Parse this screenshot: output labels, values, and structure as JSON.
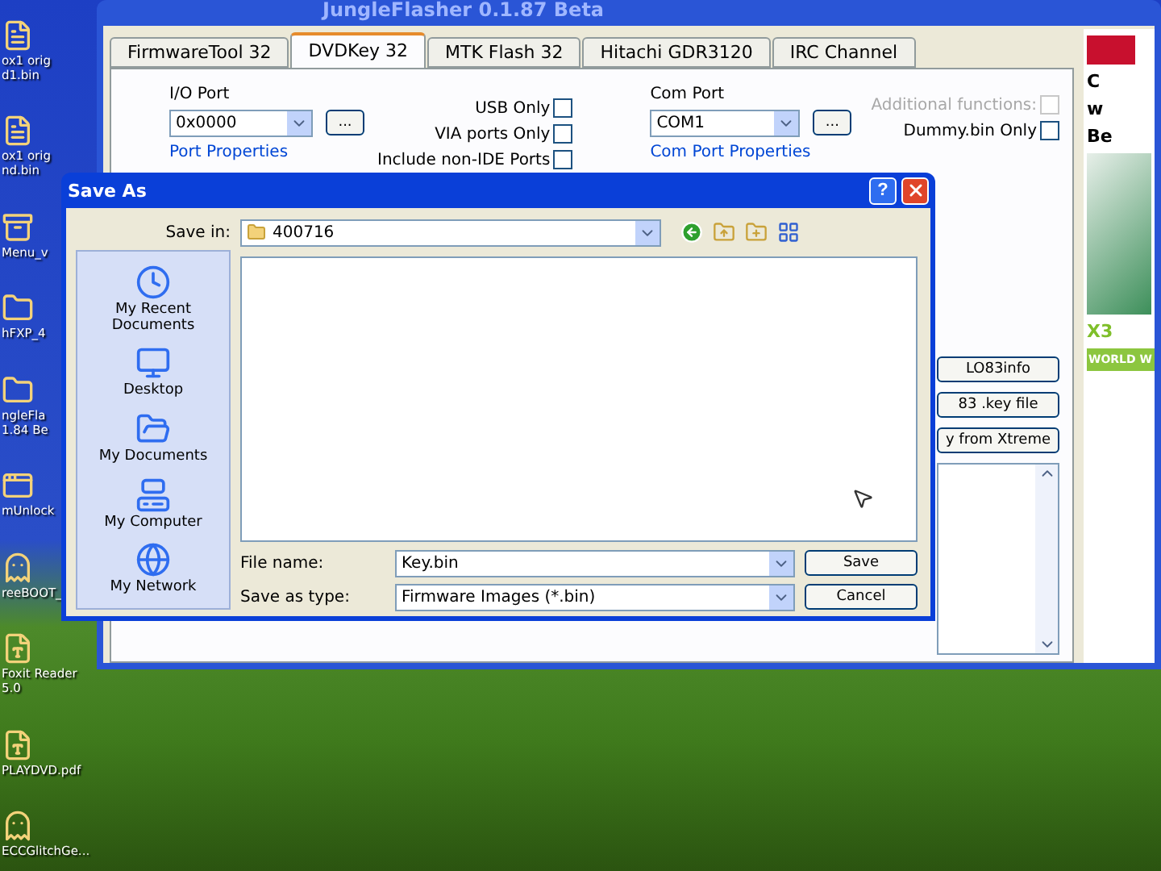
{
  "desktop": {
    "icons": [
      {
        "kind": "file",
        "lines": [
          "ox1 orig",
          "d1.bin"
        ]
      },
      {
        "kind": "file",
        "lines": [
          "ox1 orig",
          "nd.bin"
        ]
      },
      {
        "kind": "archive",
        "lines": [
          "Menu_v"
        ]
      },
      {
        "kind": "folder",
        "lines": [
          "hFXP_4"
        ]
      },
      {
        "kind": "folder",
        "lines": [
          "ngleFla",
          "1.84 Be"
        ]
      },
      {
        "kind": "window",
        "lines": [
          "mUnlock"
        ]
      },
      {
        "kind": "creature",
        "lines": [
          "reeBOOT_"
        ]
      },
      {
        "kind": "app",
        "lines": [
          "Foxit Reader",
          "5.0"
        ]
      },
      {
        "kind": "pdf",
        "lines": [
          "PLAYDVD.pdf"
        ]
      },
      {
        "kind": "creature",
        "lines": [
          "ECCGlitchGe..."
        ]
      }
    ]
  },
  "app_window": {
    "title": "JungleFlasher 0.1.87 Beta",
    "tabs": [
      {
        "label": "FirmwareTool 32",
        "selected": false
      },
      {
        "label": "DVDKey 32",
        "selected": true
      },
      {
        "label": "MTK Flash 32",
        "selected": false
      },
      {
        "label": "Hitachi GDR3120",
        "selected": false
      },
      {
        "label": "IRC Channel",
        "selected": false
      }
    ],
    "io_port": {
      "label": "I/O Port",
      "value": "0x0000",
      "browse": "...",
      "group": "Port Properties"
    },
    "port_options": [
      {
        "label": "USB Only",
        "checked": false
      },
      {
        "label": "VIA ports Only",
        "checked": false
      },
      {
        "label": "Include non-IDE Ports",
        "checked": false
      }
    ],
    "com_port": {
      "label": "Com Port",
      "value": "COM1",
      "browse": "...",
      "group": "Com Port Properties"
    },
    "extra_options": [
      {
        "label": "Additional functions:",
        "checked": false,
        "disabled": true
      },
      {
        "label": "Dummy.bin Only",
        "checked": false,
        "disabled": false
      }
    ],
    "buttons": [
      "LO83info",
      "83 .key file",
      "y from Xtreme"
    ],
    "ad": {
      "lines": [
        "C",
        "w",
        "Be"
      ],
      "brand": "X3",
      "banner": "WORLD W"
    }
  },
  "save_dialog": {
    "title": "Save As",
    "help": "?",
    "save_in": {
      "label": "Save in:",
      "value": "400716"
    },
    "places": [
      {
        "kind": "recent",
        "label": "My Recent Documents"
      },
      {
        "kind": "desktop",
        "label": "Desktop"
      },
      {
        "kind": "documents",
        "label": "My Documents"
      },
      {
        "kind": "computer",
        "label": "My Computer"
      },
      {
        "kind": "network",
        "label": "My Network"
      }
    ],
    "file_name": {
      "label": "File name:",
      "value": "Key.bin"
    },
    "save_as_type": {
      "label": "Save as type:",
      "value": "Firmware Images (*.bin)"
    },
    "buttons": [
      "Save",
      "Cancel"
    ]
  }
}
